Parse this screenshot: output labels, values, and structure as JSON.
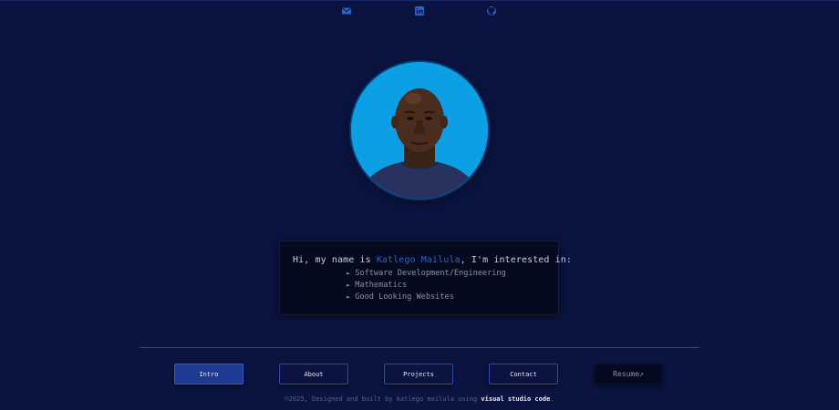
{
  "social": {
    "items": [
      {
        "icon": "mail-icon"
      },
      {
        "icon": "linkedin-icon"
      },
      {
        "icon": "github-icon"
      }
    ]
  },
  "profile": {
    "avatar_description": "profile-photo"
  },
  "intro": {
    "greeting_prefix": "Hi, my name is ",
    "name": "Katlego Mailula",
    "greeting_suffix": ", I'm interested in:",
    "interests": [
      "Software Development/Engineering",
      "Mathematics",
      "Good Looking Websites"
    ]
  },
  "nav": {
    "intro": "Intro",
    "about": "About",
    "projects": "Projects",
    "contact": "Contact",
    "resume": "Resume↗"
  },
  "footer": {
    "prefix": "©2025, Designed and built by katlego mailula using ",
    "tool": "visual studio code",
    "suffix": "."
  },
  "colors": {
    "background": "#0b1440",
    "accent": "#2f62c8",
    "card": "#060a1e",
    "avatar_bg": "#0d9fe3"
  }
}
